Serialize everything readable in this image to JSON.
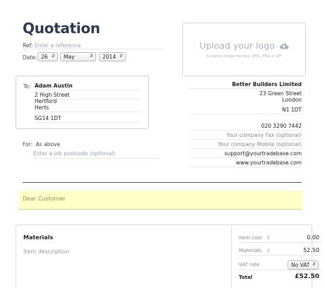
{
  "title": "Quotation",
  "ref": {
    "label": "Ref:",
    "placeholder": "Enter a reference"
  },
  "date": {
    "label": "Date:",
    "day": "26",
    "month": "May",
    "year": "2014"
  },
  "logo": {
    "upload_label": "Upload your logo",
    "formats_note": "Accepted image formats: JPEG, PNG or GIF",
    "icon": "cloud-upload-icon"
  },
  "to": {
    "label": "To:",
    "name": "Adam Austin",
    "address": [
      "2 High Street",
      "Hertford",
      "Herts"
    ],
    "postcode": "SG14 1DT"
  },
  "company": {
    "name": "Better Builders Limited",
    "address": [
      "23 Green Street",
      "London",
      "N1 1DT"
    ],
    "phone": "020 3290 7442",
    "fax_placeholder": "Your company Fax (optional)",
    "mobile_placeholder": "Your company Mobile (optional)",
    "email": "support@yourtradebase.com",
    "website": "www.yourtradebase.com"
  },
  "for": {
    "label": "For:",
    "value": "As above",
    "postcode_placeholder": "Enter a job postcode (optional)"
  },
  "greeting": "Dear Customer",
  "materials": {
    "heading": "Materials",
    "description_placeholder": "Item description",
    "item_cost_label": "Item cost",
    "currency": "£",
    "item_cost_value": "0.00",
    "materials_label": "Materials",
    "materials_value": "52.50",
    "vat_label": "VAT rate",
    "vat_value": "No VAT",
    "total_label": "Total",
    "total_value": "£52.50"
  }
}
